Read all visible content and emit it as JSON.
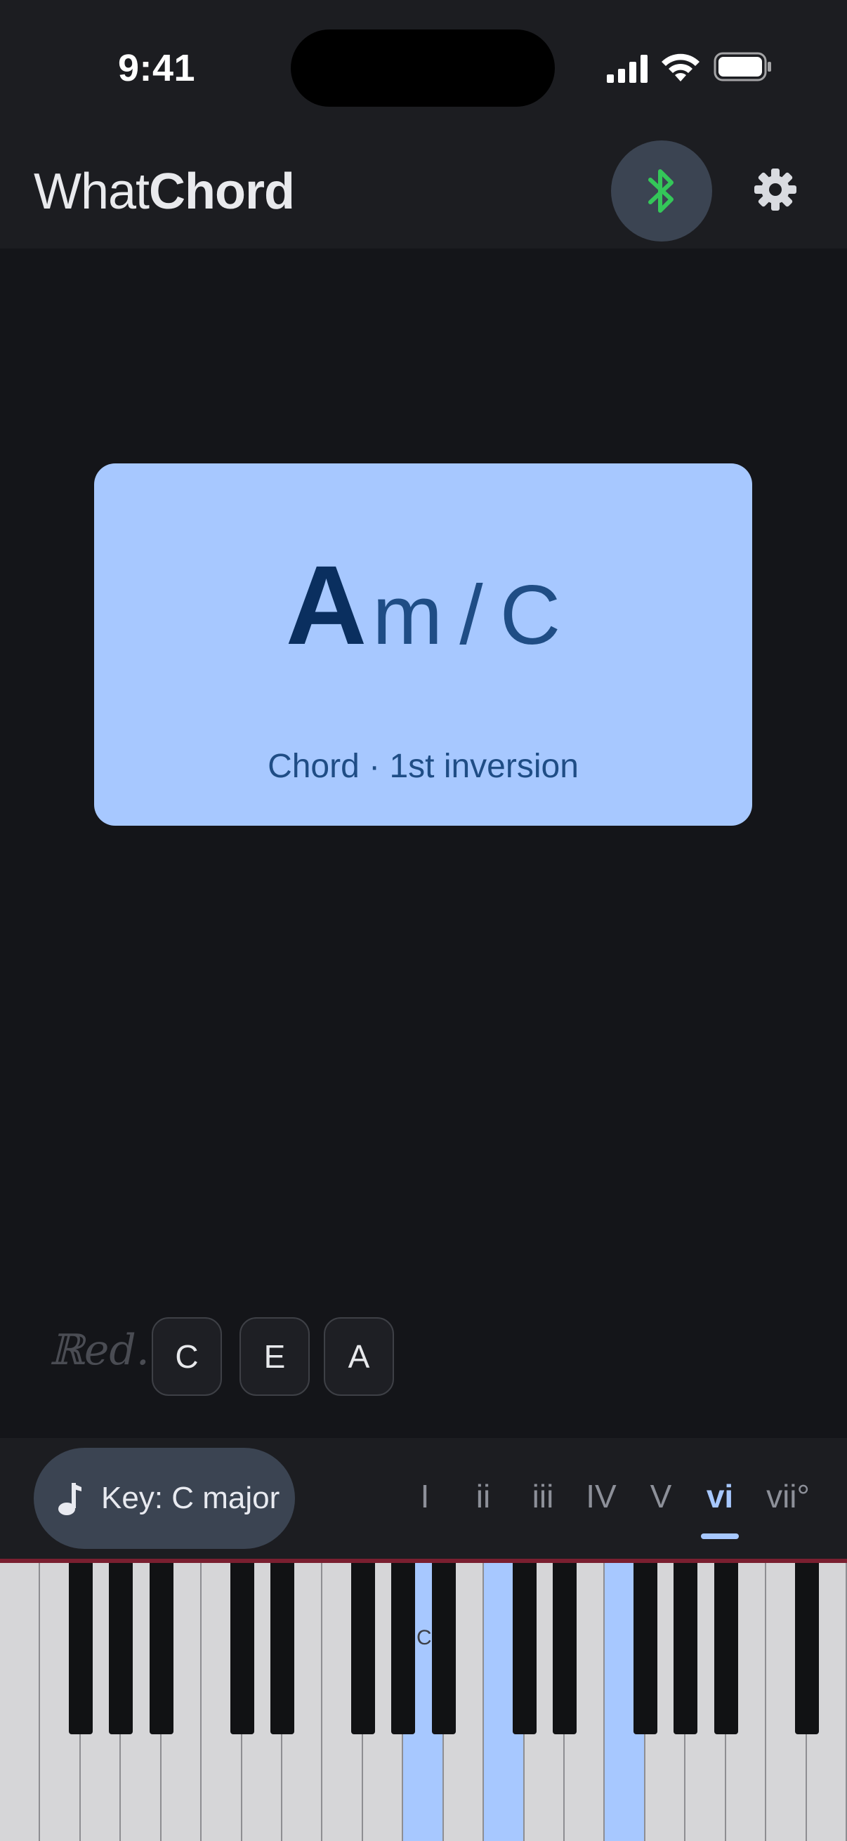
{
  "status_bar": {
    "time": "9:41"
  },
  "header": {
    "title_light": "What",
    "title_bold": "Chord"
  },
  "chord": {
    "root": "A",
    "quality": "m",
    "slash": "/",
    "bass": "C",
    "description": "Chord · 1st inversion"
  },
  "pedal_mark": "ℝed.",
  "notes": [
    "C",
    "E",
    "A"
  ],
  "key": {
    "label": "Key: C major"
  },
  "degrees": [
    "I",
    "ii",
    "iii",
    "IV",
    "V",
    "vi",
    "vii°"
  ],
  "active_degree": "vi",
  "piano": {
    "c_label": "C"
  },
  "colors": {
    "accent": "#a7c8ff",
    "bluetooth": "#34c759",
    "background": "#141519"
  }
}
